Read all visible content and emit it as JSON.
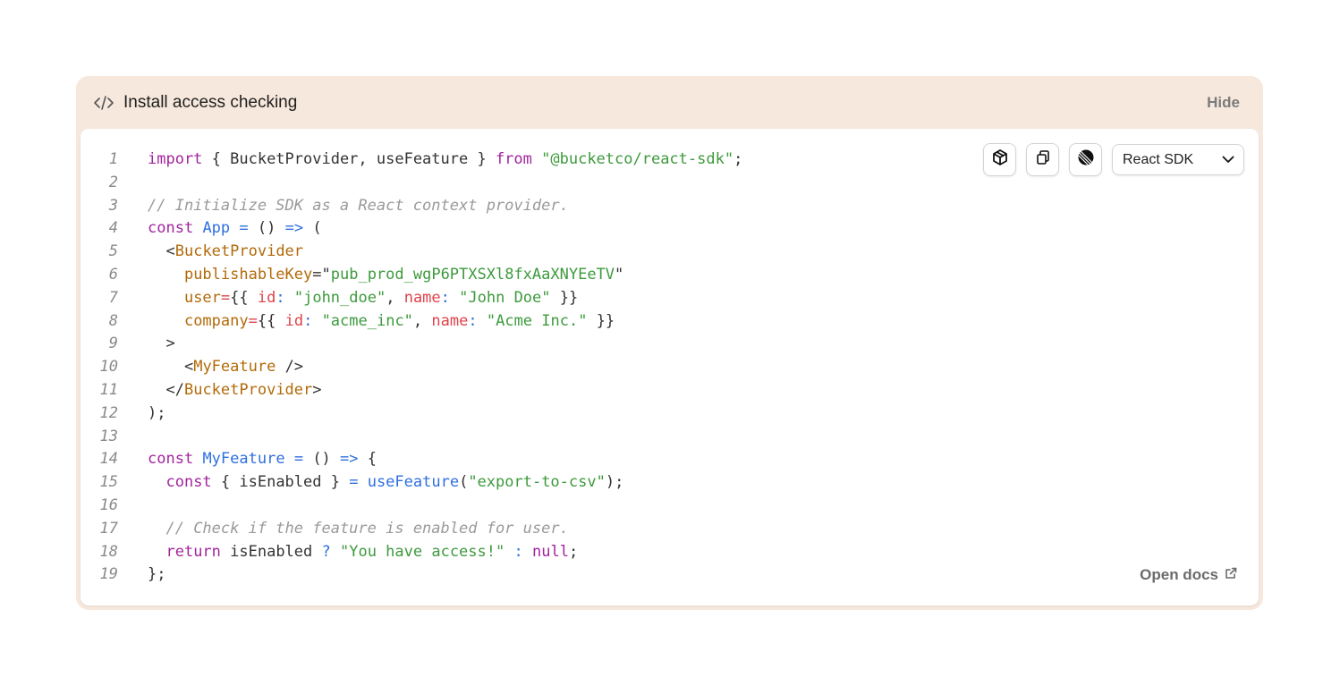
{
  "header": {
    "title": "Install access checking",
    "hide_label": "Hide"
  },
  "toolbar": {
    "select_value": "React SDK",
    "icons": [
      "package-icon",
      "copy-icon",
      "linear-logo-icon"
    ]
  },
  "footer": {
    "open_docs_label": "Open docs"
  },
  "code": {
    "line_numbers": [
      "1",
      "2",
      "3",
      "4",
      "5",
      "6",
      "7",
      "8",
      "9",
      "10",
      "11",
      "12",
      "13",
      "14",
      "15",
      "16",
      "17",
      "18",
      "19"
    ],
    "tokens": {
      "l1_import": "import",
      "l1_mid": " { BucketProvider, useFeature } ",
      "l1_from": "from",
      "l1_str": "\"@bucketco/react-sdk\"",
      "l1_end": ";",
      "l3_comment": "// Initialize SDK as a React context provider.",
      "l4_const": "const",
      "l4_name": "App",
      "l4_eq": "=",
      "l4_paren": "()",
      "l4_arrow": "=>",
      "l4_open": "(",
      "l5_lt": "<",
      "l5_tag": "BucketProvider",
      "l6_attr": "publishableKey",
      "l6_eq": "=",
      "l6_q": "\"",
      "l6_val": "pub_prod_wgP6PTXSXl8fxAaXNYEeTV",
      "l6_q2": "\"",
      "l7_attr": "user",
      "l7_eq": "=",
      "l7_open": "{{ ",
      "l7_k1": "id",
      "l7_c1": ":",
      "l7_v1": "\"john_doe\"",
      "l7_sep": ", ",
      "l7_k2": "name",
      "l7_c2": ":",
      "l7_v2": "\"John Doe\"",
      "l7_close": " }}",
      "l8_attr": "company",
      "l8_eq": "=",
      "l8_open": "{{ ",
      "l8_k1": "id",
      "l8_c1": ":",
      "l8_v1": "\"acme_inc\"",
      "l8_sep": ", ",
      "l8_k2": "name",
      "l8_c2": ":",
      "l8_v2": "\"Acme Inc.\"",
      "l8_close": " }}",
      "l9_gt": ">",
      "l10_lt": "<",
      "l10_tag": "MyFeature",
      "l10_end": " />",
      "l11_lt": "</",
      "l11_tag": "BucketProvider",
      "l11_gt": ">",
      "l12": ");",
      "l14_const": "const",
      "l14_name": "MyFeature",
      "l14_eq": "=",
      "l14_paren": "()",
      "l14_arrow": "=>",
      "l14_open": "{",
      "l15_const": "const",
      "l15_mid": " { isEnabled } ",
      "l15_eq": "=",
      "l15_fn": "useFeature",
      "l15_po": "(",
      "l15_str": "\"export-to-csv\"",
      "l15_pc": ");",
      "l17_comment": "// Check if the feature is enabled for user.",
      "l18_return": "return",
      "l18_var": " isEnabled ",
      "l18_q": "?",
      "l18_str": "\"You have access!\"",
      "l18_colon": ":",
      "l18_null": "null",
      "l18_end": ";",
      "l19": "};"
    }
  },
  "colors": {
    "panel_bg": "#f6e8dc",
    "keyword": "#a1259e",
    "function": "#2f6fe0",
    "string": "#3d9a3d",
    "tag": "#b26a0a",
    "property": "#e0424a",
    "comment": "#9a9a9a"
  }
}
